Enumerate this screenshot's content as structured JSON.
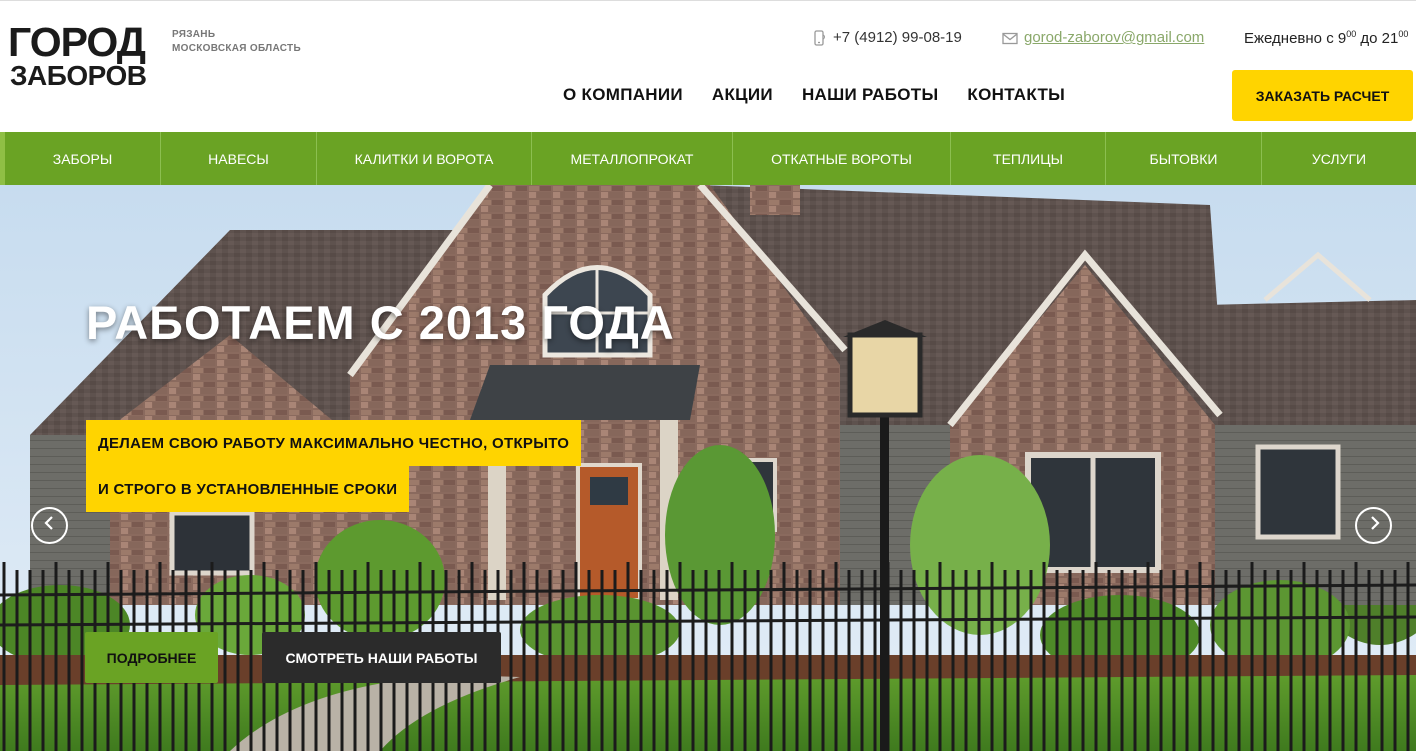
{
  "logo": {
    "line1": "ГОРОД",
    "line2": "ЗАБОРОВ"
  },
  "region": {
    "city": "РЯЗАНЬ",
    "area": "МОСКОВСКАЯ ОБЛАСТЬ"
  },
  "contacts": {
    "phone": "+7 (4912) 99-08-19",
    "email": "gorod-zaborov@gmail.com",
    "hours_prefix": "Ежедневно с 9",
    "hours_from_sup": "00",
    "hours_mid": " до 21",
    "hours_to_sup": "00"
  },
  "top_nav": [
    "О КОМПАНИИ",
    "АКЦИИ",
    "НАШИ РАБОТЫ",
    "КОНТАКТЫ"
  ],
  "order_button": "ЗАКАЗАТЬ РАСЧЕТ",
  "categories": [
    "ЗАБОРЫ",
    "НАВЕСЫ",
    "КАЛИТКИ И ВОРОТА",
    "МЕТАЛЛОПРОКАТ",
    "ОТКАТНЫЕ ВОРОТЫ",
    "ТЕПЛИЦЫ",
    "БЫТОВКИ",
    "УСЛУГИ"
  ],
  "hero": {
    "title": "РАБОТАЕМ С 2013 ГОДА",
    "subtitle_line1": "ДЕЛАЕМ СВОЮ РАБОТУ МАКСИМАЛЬНО ЧЕСТНО, ОТКРЫТО",
    "subtitle_line2": "И СТРОГО В УСТАНОВЛЕННЫЕ СРОКИ",
    "btn_more": "ПОДРОБНЕЕ",
    "btn_works": "СМОТРЕТЬ НАШИ РАБОТЫ"
  },
  "icons": {
    "phone": "phone-icon",
    "email": "envelope-icon",
    "prev": "chevron-left-icon",
    "next": "chevron-right-icon"
  },
  "colors": {
    "accent_yellow": "#ffd400",
    "brand_green": "#6aa324",
    "dark_button": "#2b2b2b"
  }
}
